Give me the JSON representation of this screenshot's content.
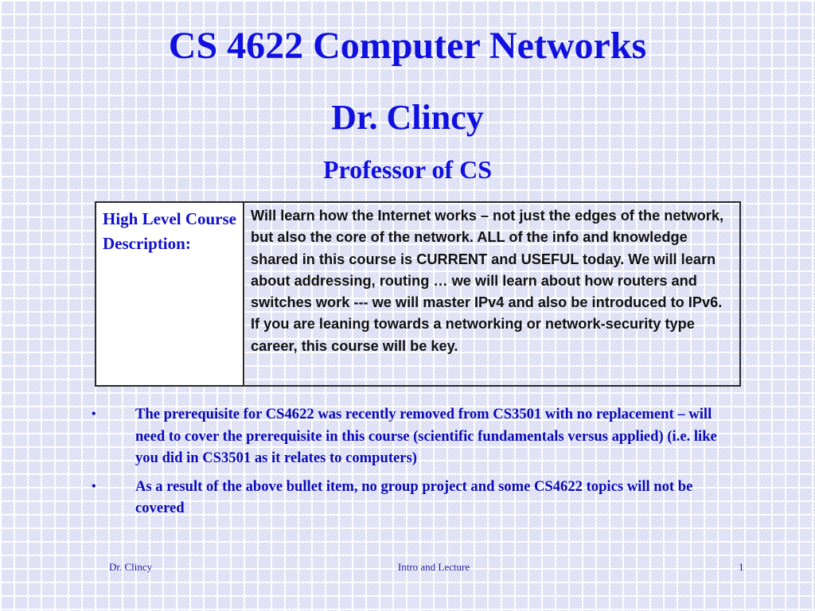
{
  "slide": {
    "title": "CS 4622 Computer Networks",
    "presenter": "Dr. Clincy",
    "role": "Professor of CS"
  },
  "description_table": {
    "label": "High Level Course Description:",
    "body": "Will learn how the Internet works – not just the edges of the network, but also the core of the network.  ALL of the info and knowledge shared in this course is CURRENT and USEFUL today. We will learn about addressing, routing … we will learn about how routers and switches work --- we will master IPv4 and also be introduced to IPv6.  If you are leaning towards a networking or network-security type career, this course will be key."
  },
  "bullets": [
    {
      "symbol": "•",
      "text": "The prerequisite for CS4622 was recently removed from CS3501 with no replacement – will need to cover the prerequisite in this course (scientific fundamentals versus applied) (i.e. like you did in CS3501 as it relates to computers)"
    },
    {
      "symbol": "•",
      "text": "As a result of the above bullet item, no group project and some CS4622 topics will not be covered"
    }
  ],
  "footer": {
    "left": "Dr. Clincy",
    "center": "Intro and Lecture",
    "page_number": "1"
  },
  "colors": {
    "title_blue": "#1010e0",
    "bullet_blue": "#0a0ab8",
    "body_text": "#111111",
    "background": "#e2e4f6"
  }
}
